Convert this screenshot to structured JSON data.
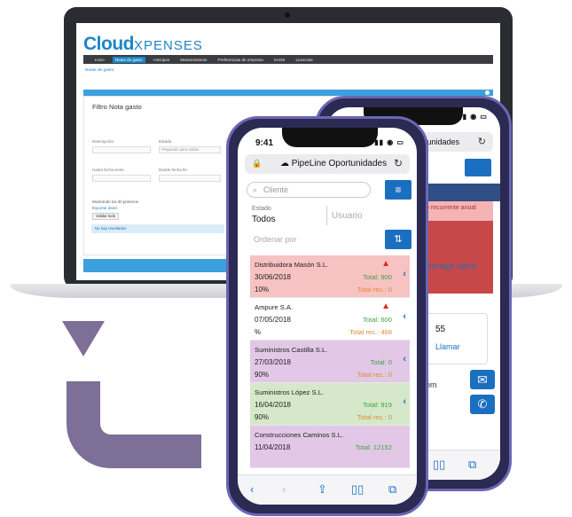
{
  "laptop": {
    "logo_bold": "Cloud",
    "logo_thin": "XPENSES",
    "nav": [
      "Inicio",
      "Notas de gasto",
      "Anticipos",
      "Mantenimiento",
      "Preferencias de empresa",
      "SAGE",
      "Licencias"
    ],
    "breadcrumb": "Notas de gasto",
    "panel_title": "Filtro Nota gasto",
    "label_descripcion": "Descripción",
    "label_estado": "Estado",
    "label_usuario": "Usuari",
    "estado_value": "Preparado para validar",
    "label_hasta_fecha": "Hasta fecha texto",
    "label_desde_fecha": "Desde fecha fin",
    "mostrando": "Mostrando los 30 primeros",
    "exportar": "Exportar datos",
    "validar": "Validar todo",
    "no_results": "No hay resultados"
  },
  "back_phone": {
    "address_text": "unidades",
    "red_box_text": "o recurrente anual",
    "link_text": "rcentaje cierre",
    "card_number": "55",
    "card_action": "Llamar",
    "text_om": "om"
  },
  "front_phone": {
    "time": "9:41",
    "title": "PipeLine Oportunidades",
    "search_placeholder": "Cliente",
    "estado_label": "Estado",
    "estado_value": "Todos",
    "usuario_placeholder": "Usuario",
    "ordenar_placeholder": "Ordenar por",
    "items": [
      {
        "name": "Distribuidora Masón S.L.",
        "date": "30/06/2018",
        "pct": "10%",
        "total": "Total: 900",
        "total_rec": "Total rec.: 0",
        "color": "red",
        "warning": true
      },
      {
        "name": "Ampure S.A.",
        "date": "07/05/2018",
        "pct": "%",
        "total": "Total: 600",
        "total_rec": "Total rec.: 468",
        "color": "white",
        "warning": true
      },
      {
        "name": "Suministros Castilla S.L.",
        "date": "27/03/2018",
        "pct": "90%",
        "total": "Total: 0",
        "total_rec": "Total rec.: 0",
        "color": "purple",
        "warning": false
      },
      {
        "name": "Suministros López S.L.",
        "date": "16/04/2018",
        "pct": "90%",
        "total": "Total: 919",
        "total_rec": "Total rec.: 0",
        "color": "green",
        "warning": false
      },
      {
        "name": "Construcciones Caminos S.L.",
        "date": "11/04/2018",
        "pct": "",
        "total": "Total: 12152",
        "total_rec": "",
        "color": "purple",
        "warning": false
      }
    ]
  },
  "colors": {
    "brand_blue": "#1b86c7",
    "button_blue": "#1b6fc0",
    "arrow_purple": "#7d6f97",
    "phone_frame": "#6b67b5"
  }
}
